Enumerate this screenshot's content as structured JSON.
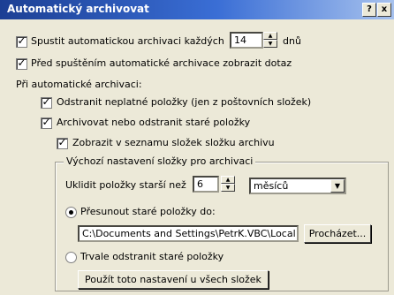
{
  "window": {
    "title": "Automatický archivovat",
    "help_label": "?",
    "close_label": "x"
  },
  "glyphs": {
    "check": "✓",
    "up": "▲",
    "down": "▼"
  },
  "auto_archive": {
    "checked": true,
    "label_prefix": "Spustit automatickou archivaci každých",
    "days_value": "14",
    "days_unit": "dnů"
  },
  "prompt_before": {
    "checked": true,
    "label": "Před spuštěním automatické archivace zobrazit dotaz"
  },
  "section_label": "Při automatické archivaci:",
  "delete_expired": {
    "checked": true,
    "label": "Odstranit neplatné položky (jen z poštovních složek)"
  },
  "archive_old": {
    "checked": true,
    "label": "Archivovat nebo odstranit staré položky"
  },
  "show_folder": {
    "checked": true,
    "label": "Zobrazit v seznamu složek složku archivu"
  },
  "group": {
    "legend": "Výchozí nastavení složky pro archivaci",
    "clean_label": "Uklidit položky starší než",
    "age_value": "6",
    "age_unit_selected": "měsíců",
    "move_radio_label": "Přesunout staré položky do:",
    "move_selected": true,
    "path_value": "C:\\Documents and Settings\\PetrK.VBC\\Local Se",
    "browse_label": "Procházet...",
    "delete_radio_label": "Trvale odstranit staré položky",
    "apply_all_label": "Použít toto nastavení u všech složek"
  }
}
